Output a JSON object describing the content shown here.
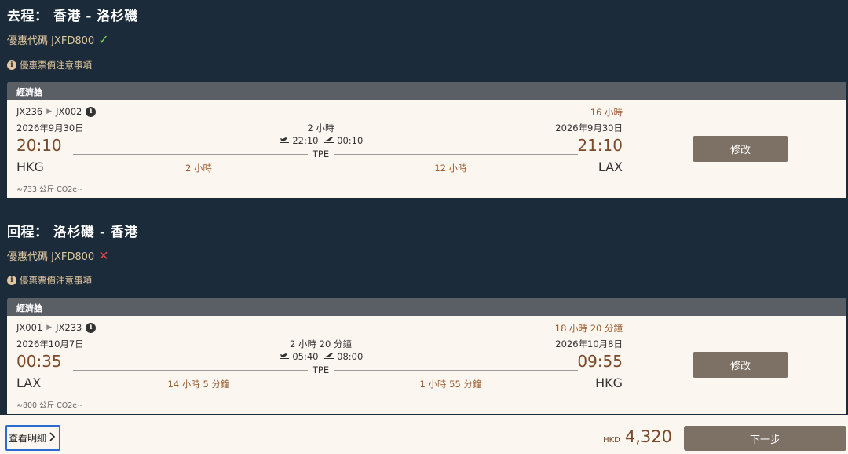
{
  "outbound": {
    "title": "去程： 香港 - 洛杉磯",
    "promo_label": "優惠代碼 JXFD800",
    "promo_status": "✓",
    "notice": "優惠票價注意事項",
    "cabin": "經濟艙",
    "flight1": "JX236",
    "flight2": "JX002",
    "total_duration": "16 小時",
    "dep_date": "2026年9月30日",
    "arr_date": "2026年9月30日",
    "layover": "2 小時",
    "stop_arr": "22:10",
    "stop_dep": "00:10",
    "dep_time": "20:10",
    "arr_time": "21:10",
    "stop_airport": "TPE",
    "dep_airport": "HKG",
    "arr_airport": "LAX",
    "seg1_duration": "2 小時",
    "seg2_duration": "12 小時",
    "co2": "≈733 公斤 CO2e~",
    "edit_label": "修改"
  },
  "inbound": {
    "title": "回程： 洛杉磯 - 香港",
    "promo_label": "優惠代碼 JXFD800",
    "promo_status": "✕",
    "notice": "優惠票價注意事項",
    "cabin": "經濟艙",
    "flight1": "JX001",
    "flight2": "JX233",
    "total_duration": "18 小時 20 分鐘",
    "dep_date": "2026年10月7日",
    "arr_date": "2026年10月8日",
    "layover": "2 小時 20 分鐘",
    "stop_arr": "05:40",
    "stop_dep": "08:00",
    "dep_time": "00:35",
    "arr_time": "09:55",
    "stop_airport": "TPE",
    "dep_airport": "LAX",
    "arr_airport": "HKG",
    "seg1_duration": "14 小時 5 分鐘",
    "seg2_duration": "1 小時 55 分鐘",
    "co2": "≈800 公斤 CO2e~",
    "edit_label": "修改"
  },
  "footer": {
    "details_label": "查看明細",
    "currency": "HKD",
    "price": "4,320",
    "next_label": "下一步"
  },
  "colors": {
    "background": "#1c2b39",
    "accent_gold": "#e0c7a0",
    "button": "#7d7166",
    "check": "#7ed957",
    "cross": "#e04343"
  }
}
